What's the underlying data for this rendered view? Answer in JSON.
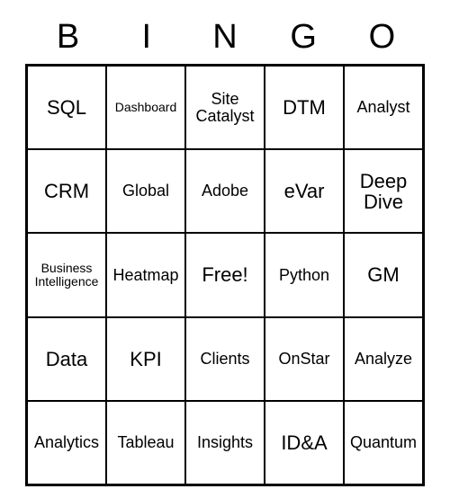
{
  "header": [
    "B",
    "I",
    "N",
    "G",
    "O"
  ],
  "grid": [
    [
      {
        "text": "SQL",
        "size": "normal"
      },
      {
        "text": "Dashboard",
        "size": "small"
      },
      {
        "text": "Site Catalyst",
        "size": "med"
      },
      {
        "text": "DTM",
        "size": "normal"
      },
      {
        "text": "Analyst",
        "size": "med"
      }
    ],
    [
      {
        "text": "CRM",
        "size": "normal"
      },
      {
        "text": "Global",
        "size": "med"
      },
      {
        "text": "Adobe",
        "size": "med"
      },
      {
        "text": "eVar",
        "size": "normal"
      },
      {
        "text": "Deep Dive",
        "size": "normal"
      }
    ],
    [
      {
        "text": "Business Intelligence",
        "size": "small"
      },
      {
        "text": "Heatmap",
        "size": "med"
      },
      {
        "text": "Free!",
        "size": "normal"
      },
      {
        "text": "Python",
        "size": "med"
      },
      {
        "text": "GM",
        "size": "normal"
      }
    ],
    [
      {
        "text": "Data",
        "size": "normal"
      },
      {
        "text": "KPI",
        "size": "normal"
      },
      {
        "text": "Clients",
        "size": "med"
      },
      {
        "text": "OnStar",
        "size": "med"
      },
      {
        "text": "Analyze",
        "size": "med"
      }
    ],
    [
      {
        "text": "Analytics",
        "size": "med"
      },
      {
        "text": "Tableau",
        "size": "med"
      },
      {
        "text": "Insights",
        "size": "med"
      },
      {
        "text": "ID&A",
        "size": "normal"
      },
      {
        "text": "Quantum",
        "size": "med"
      }
    ]
  ]
}
